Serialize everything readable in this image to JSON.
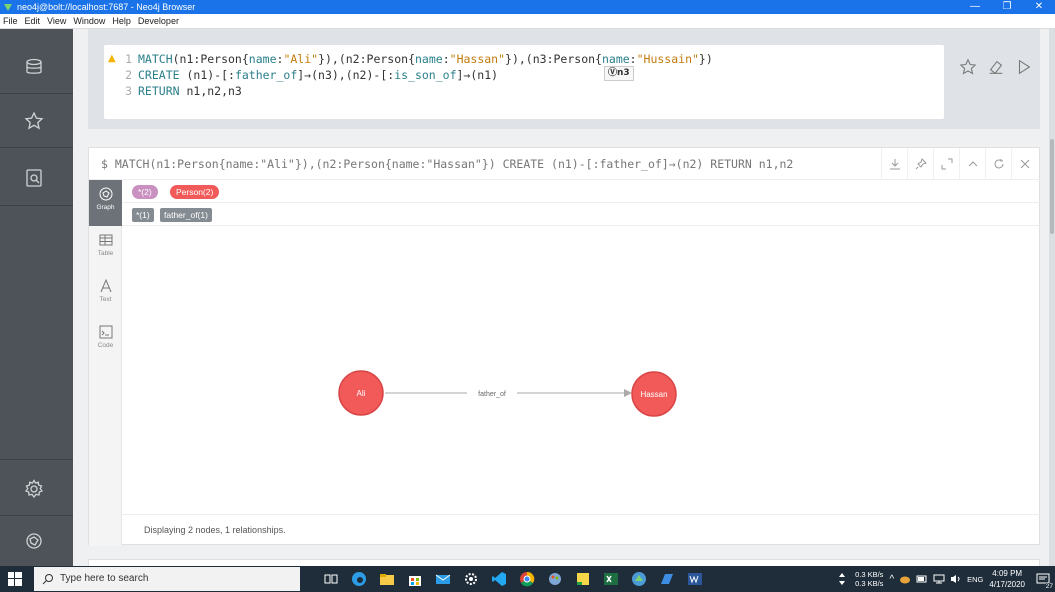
{
  "window": {
    "title": "neo4j@bolt://localhost:7687 - Neo4j Browser",
    "minimize": "—",
    "maximize": "❐",
    "close": "✕"
  },
  "menu": [
    "File",
    "Edit",
    "View",
    "Window",
    "Help",
    "Developer"
  ],
  "sidebar": {
    "icons": [
      "database-icon",
      "star-icon",
      "document-search-icon",
      "gear-icon",
      "neo4j-logo-icon"
    ]
  },
  "editor": {
    "line_numbers": [
      "1",
      "2",
      "3"
    ],
    "lines": [
      [
        {
          "t": "kw",
          "v": "MATCH"
        },
        {
          "t": "tx",
          "v": "(n1:Person{"
        },
        {
          "t": "kw",
          "v": "name"
        },
        {
          "t": "tx",
          "v": ":"
        },
        {
          "t": "str",
          "v": "\"Ali\""
        },
        {
          "t": "tx",
          "v": "}),(n2:Person{"
        },
        {
          "t": "kw",
          "v": "name"
        },
        {
          "t": "tx",
          "v": ":"
        },
        {
          "t": "str",
          "v": "\"Hassan\""
        },
        {
          "t": "tx",
          "v": "}),(n3:Person{"
        },
        {
          "t": "kw",
          "v": "name"
        },
        {
          "t": "tx",
          "v": ":"
        },
        {
          "t": "str",
          "v": "\"Hussain\""
        },
        {
          "t": "tx",
          "v": "})"
        }
      ],
      [
        {
          "t": "kw",
          "v": "CREATE"
        },
        {
          "t": "tx",
          "v": " (n1)-[:"
        },
        {
          "t": "kw",
          "v": "father_of"
        },
        {
          "t": "tx",
          "v": "]→(n3),(n2)-[:"
        },
        {
          "t": "kw",
          "v": "is_son_of"
        },
        {
          "t": "tx",
          "v": "]→(n1)"
        }
      ],
      [
        {
          "t": "kw",
          "v": "RETURN"
        },
        {
          "t": "tx",
          "v": " n1,n2,n3"
        }
      ]
    ],
    "warning_icon": "▲",
    "variable_badge": "Ⓥn3"
  },
  "frame": {
    "query": "$ MATCH(n1:Person{name:\"Ali\"}),(n2:Person{name:\"Hassan\"}) CREATE (n1)-[:father_of]→(n2) RETURN n1,n2",
    "tabs": [
      {
        "label": "Graph",
        "icon": "graph-icon",
        "active": true
      },
      {
        "label": "Table",
        "icon": "table-icon",
        "active": false
      },
      {
        "label": "Text",
        "icon": "text-icon",
        "active": false
      },
      {
        "label": "Code",
        "icon": "code-icon",
        "active": false
      }
    ],
    "node_labels": [
      {
        "label": "*(2)",
        "color": "#c990c0"
      },
      {
        "label": "Person(2)",
        "color": "#f25a5a"
      }
    ],
    "rel_types": [
      {
        "label": "*(1)"
      },
      {
        "label": "father_of(1)"
      }
    ],
    "graph": {
      "nodes": [
        {
          "id": "ali",
          "caption": "Ali",
          "color": "#f25a5a"
        },
        {
          "id": "hassan",
          "caption": "Hassan",
          "color": "#f25a5a"
        }
      ],
      "relationship": {
        "type": "father_of",
        "from": "ali",
        "to": "hassan"
      }
    },
    "status": "Displaying 2 nodes, 1 relationships."
  },
  "taskbar": {
    "search_placeholder": "Type here to search",
    "net_up": "0.3 KB/s",
    "net_down": "0.3 KB/s",
    "lang": "ENG",
    "time": "4:09 PM",
    "date": "4/17/2020",
    "notif_count": "27"
  },
  "colors": {
    "accent": "#1a73e8",
    "sidebar": "#4d5358",
    "node": "#f25a5a",
    "node_border": "#d84545"
  }
}
